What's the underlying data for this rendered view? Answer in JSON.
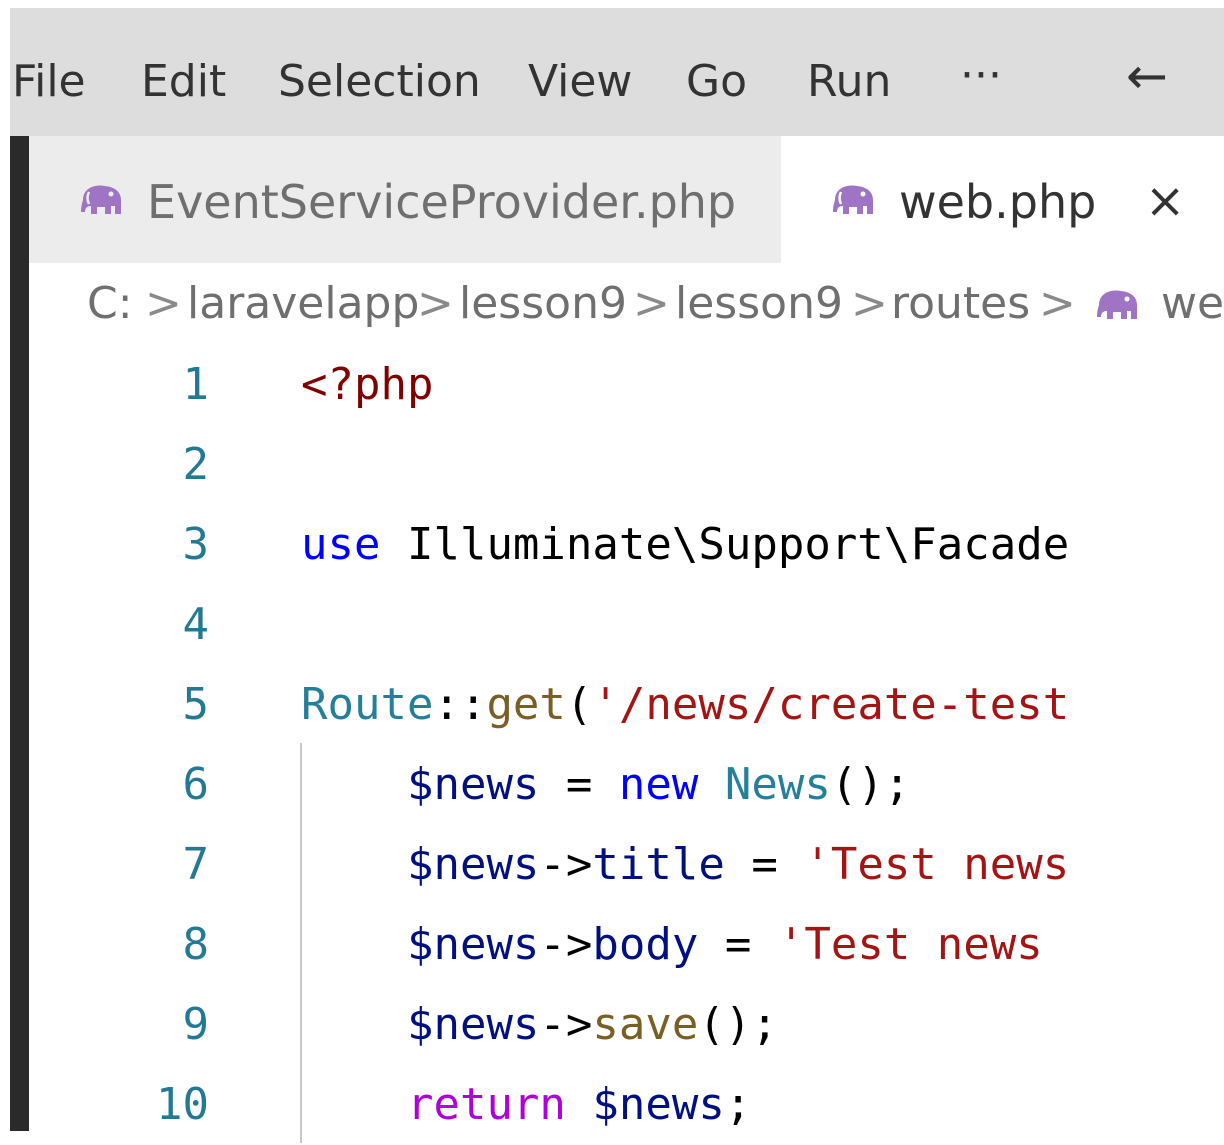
{
  "menu": {
    "items": [
      "File",
      "Edit",
      "Selection",
      "View",
      "Go",
      "Run"
    ],
    "more": "···",
    "back_arrow": "←"
  },
  "tabs": [
    {
      "label": "EventServiceProvider.php",
      "icon": "php-elephant-icon",
      "active": false
    },
    {
      "label": "web.php",
      "icon": "php-elephant-icon",
      "active": true,
      "close": "×"
    }
  ],
  "breadcrumb": {
    "parts": [
      "C:",
      "laravelapp",
      "lesson9",
      "lesson9",
      "routes",
      "we"
    ],
    "separator": ">"
  },
  "editor": {
    "line_numbers": [
      "1",
      "2",
      "3",
      "4",
      "5",
      "6",
      "7",
      "8",
      "9",
      "10"
    ],
    "lines": [
      [
        {
          "t": "<?php",
          "c": "tag"
        }
      ],
      [],
      [
        {
          "t": "use",
          "c": "kw"
        },
        {
          "t": " Illuminate\\Support\\Facade",
          "c": "plain"
        }
      ],
      [],
      [
        {
          "t": "Route",
          "c": "type"
        },
        {
          "t": "::",
          "c": "plain"
        },
        {
          "t": "get",
          "c": "fn"
        },
        {
          "t": "(",
          "c": "plain"
        },
        {
          "t": "'/news/create-test",
          "c": "str"
        }
      ],
      [
        {
          "t": "    ",
          "c": "plain"
        },
        {
          "t": "$news",
          "c": "var"
        },
        {
          "t": " = ",
          "c": "plain"
        },
        {
          "t": "new",
          "c": "kw"
        },
        {
          "t": " ",
          "c": "plain"
        },
        {
          "t": "News",
          "c": "type"
        },
        {
          "t": "();",
          "c": "plain"
        }
      ],
      [
        {
          "t": "    ",
          "c": "plain"
        },
        {
          "t": "$news",
          "c": "var"
        },
        {
          "t": "->",
          "c": "plain"
        },
        {
          "t": "title",
          "c": "var"
        },
        {
          "t": " = ",
          "c": "plain"
        },
        {
          "t": "'Test news",
          "c": "str"
        }
      ],
      [
        {
          "t": "    ",
          "c": "plain"
        },
        {
          "t": "$news",
          "c": "var"
        },
        {
          "t": "->",
          "c": "plain"
        },
        {
          "t": "body",
          "c": "var"
        },
        {
          "t": " = ",
          "c": "plain"
        },
        {
          "t": "'Test news ",
          "c": "str"
        }
      ],
      [
        {
          "t": "    ",
          "c": "plain"
        },
        {
          "t": "$news",
          "c": "var"
        },
        {
          "t": "->",
          "c": "plain"
        },
        {
          "t": "save",
          "c": "fn"
        },
        {
          "t": "();",
          "c": "plain"
        }
      ],
      [
        {
          "t": "    ",
          "c": "plain"
        },
        {
          "t": "return",
          "c": "ctrl"
        },
        {
          "t": " ",
          "c": "plain"
        },
        {
          "t": "$news",
          "c": "var"
        },
        {
          "t": ";",
          "c": "plain"
        }
      ]
    ]
  },
  "colors": {
    "menubar_bg": "#dddddd",
    "line_number": "#237893",
    "keyword": "#0000ff",
    "control": "#af00db",
    "variable": "#001080",
    "type": "#267f99",
    "function": "#795e26",
    "string": "#a31515",
    "php_tag": "#800000",
    "php_icon": "#a074c4"
  }
}
